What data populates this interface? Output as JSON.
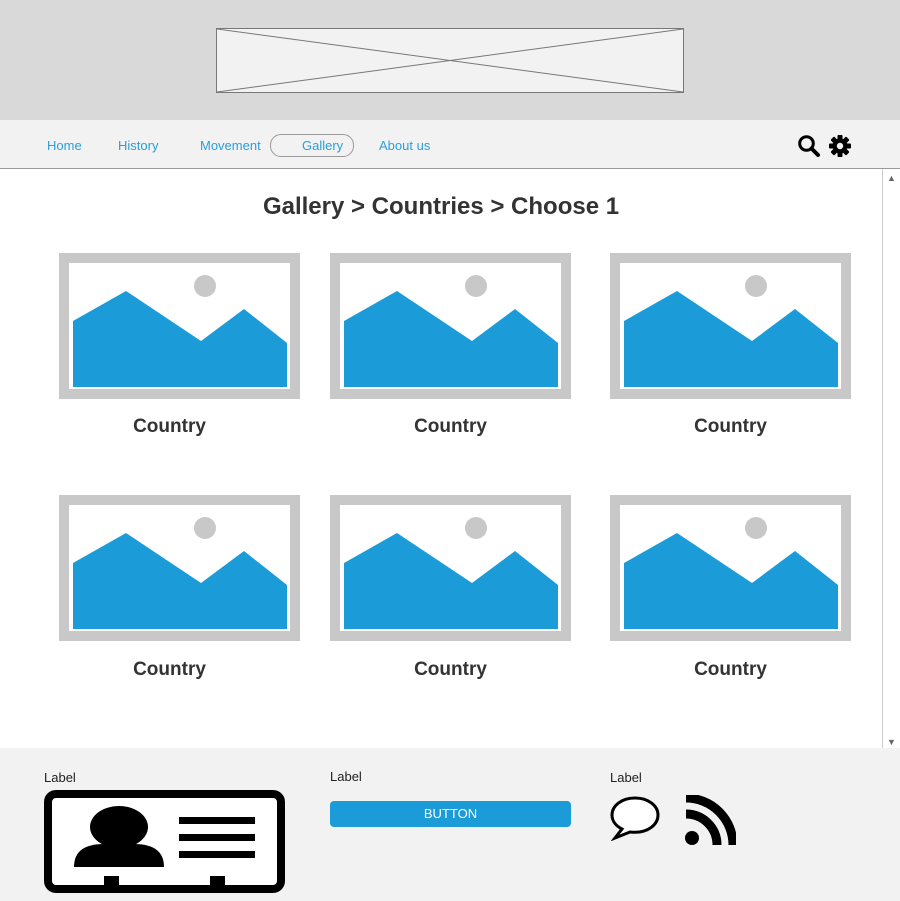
{
  "nav": {
    "items": [
      {
        "label": "Home"
      },
      {
        "label": "History"
      },
      {
        "label": "Movement"
      },
      {
        "label": "Gallery"
      },
      {
        "label": "About us"
      }
    ],
    "active": "Gallery",
    "icons": [
      "search-icon",
      "gear-icon"
    ]
  },
  "main": {
    "title": "Gallery > Countries > Choose 1",
    "cards": [
      {
        "label": "Country"
      },
      {
        "label": "Country"
      },
      {
        "label": "Country"
      },
      {
        "label": "Country"
      },
      {
        "label": "Country"
      },
      {
        "label": "Country"
      }
    ]
  },
  "footer": {
    "col1": {
      "label": "Label",
      "icon": "id-card-icon"
    },
    "col2": {
      "label": "Label",
      "button": "BUTTON"
    },
    "col3": {
      "label": "Label",
      "icons": [
        "speech-bubble-icon",
        "rss-icon"
      ]
    }
  },
  "colors": {
    "accent": "#1b9bd7",
    "header_bg": "#d9d9d9",
    "nav_bg": "#f2f2f2",
    "image_frame": "#c8c8c8"
  }
}
